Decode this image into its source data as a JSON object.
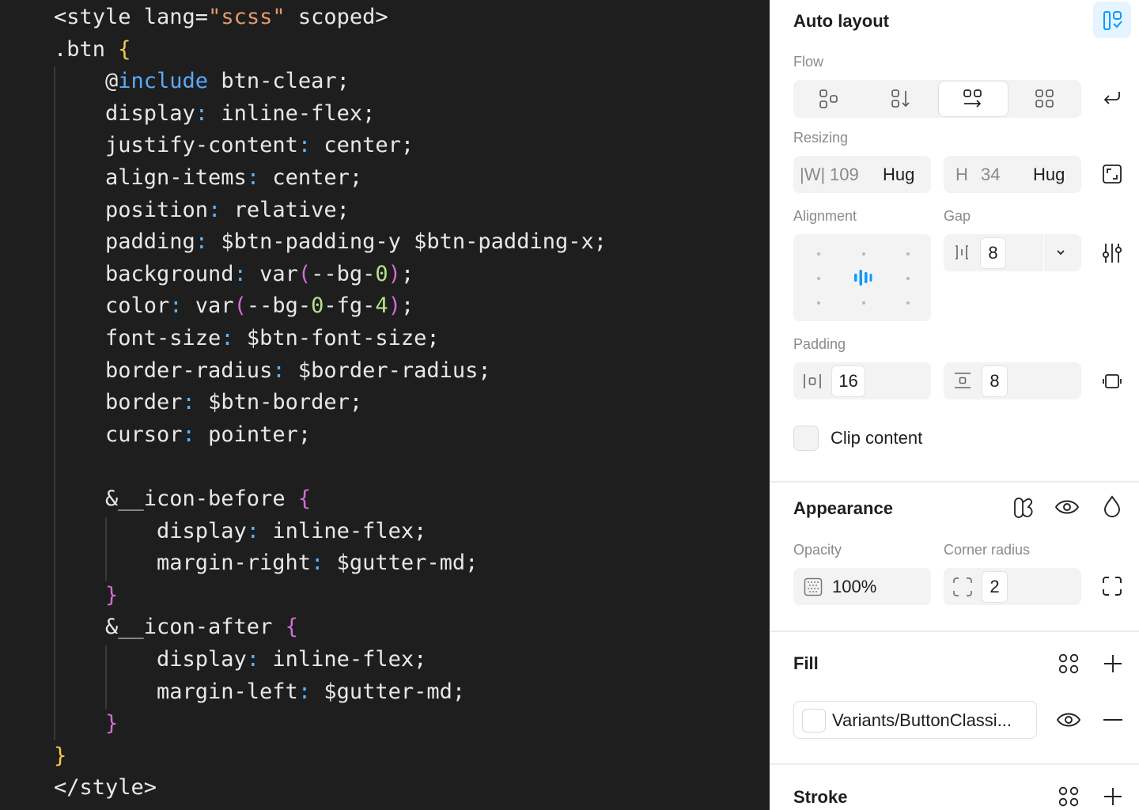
{
  "code": {
    "lines": [
      {
        "indent": 0,
        "tokens": [
          {
            "t": "<style lang=",
            "c": "t-tag"
          },
          {
            "t": "\"scss\"",
            "c": "t-str"
          },
          {
            "t": " scoped>",
            "c": "t-tag"
          }
        ]
      },
      {
        "indent": 0,
        "tokens": [
          {
            "t": ".btn ",
            "c": "t-tag"
          },
          {
            "t": "{",
            "c": "t-brace"
          }
        ]
      },
      {
        "indent": 1,
        "tokens": [
          {
            "t": "@",
            "c": "t-val"
          },
          {
            "t": "include",
            "c": "t-kw"
          },
          {
            "t": " btn-clear;",
            "c": "t-val"
          }
        ]
      },
      {
        "indent": 1,
        "tokens": [
          {
            "t": "display",
            "c": "t-prop"
          },
          {
            "t": ":",
            "c": "t-colon"
          },
          {
            "t": " inline-flex;",
            "c": "t-val"
          }
        ]
      },
      {
        "indent": 1,
        "tokens": [
          {
            "t": "justify-content",
            "c": "t-prop"
          },
          {
            "t": ":",
            "c": "t-colon"
          },
          {
            "t": " center;",
            "c": "t-val"
          }
        ]
      },
      {
        "indent": 1,
        "tokens": [
          {
            "t": "align-items",
            "c": "t-prop"
          },
          {
            "t": ":",
            "c": "t-colon"
          },
          {
            "t": " center;",
            "c": "t-val"
          }
        ]
      },
      {
        "indent": 1,
        "tokens": [
          {
            "t": "position",
            "c": "t-prop"
          },
          {
            "t": ":",
            "c": "t-colon"
          },
          {
            "t": " relative;",
            "c": "t-val"
          }
        ]
      },
      {
        "indent": 1,
        "tokens": [
          {
            "t": "padding",
            "c": "t-prop"
          },
          {
            "t": ":",
            "c": "t-colon"
          },
          {
            "t": " $btn-padding-y $btn-padding-x;",
            "c": "t-val"
          }
        ]
      },
      {
        "indent": 1,
        "tokens": [
          {
            "t": "background",
            "c": "t-prop"
          },
          {
            "t": ":",
            "c": "t-colon"
          },
          {
            "t": " var",
            "c": "t-val"
          },
          {
            "t": "(",
            "c": "t-paren"
          },
          {
            "t": "--bg-",
            "c": "t-val"
          },
          {
            "t": "0",
            "c": "t-num"
          },
          {
            "t": ")",
            "c": "t-paren"
          },
          {
            "t": ";",
            "c": "t-val"
          }
        ]
      },
      {
        "indent": 1,
        "tokens": [
          {
            "t": "color",
            "c": "t-prop"
          },
          {
            "t": ":",
            "c": "t-colon"
          },
          {
            "t": " var",
            "c": "t-val"
          },
          {
            "t": "(",
            "c": "t-paren"
          },
          {
            "t": "--bg-",
            "c": "t-val"
          },
          {
            "t": "0",
            "c": "t-num"
          },
          {
            "t": "-fg-",
            "c": "t-val"
          },
          {
            "t": "4",
            "c": "t-num"
          },
          {
            "t": ")",
            "c": "t-paren"
          },
          {
            "t": ";",
            "c": "t-val"
          }
        ]
      },
      {
        "indent": 1,
        "tokens": [
          {
            "t": "font-size",
            "c": "t-prop"
          },
          {
            "t": ":",
            "c": "t-colon"
          },
          {
            "t": " $btn-font-size;",
            "c": "t-val"
          }
        ]
      },
      {
        "indent": 1,
        "tokens": [
          {
            "t": "border-radius",
            "c": "t-prop"
          },
          {
            "t": ":",
            "c": "t-colon"
          },
          {
            "t": " $border-radius;",
            "c": "t-val"
          }
        ]
      },
      {
        "indent": 1,
        "tokens": [
          {
            "t": "border",
            "c": "t-prop"
          },
          {
            "t": ":",
            "c": "t-colon"
          },
          {
            "t": " $btn-border;",
            "c": "t-val"
          }
        ]
      },
      {
        "indent": 1,
        "tokens": [
          {
            "t": "cursor",
            "c": "t-prop"
          },
          {
            "t": ":",
            "c": "t-colon"
          },
          {
            "t": " pointer;",
            "c": "t-val"
          }
        ]
      },
      {
        "indent": 0,
        "tokens": []
      },
      {
        "indent": 1,
        "tokens": [
          {
            "t": "&__icon-before ",
            "c": "t-val"
          },
          {
            "t": "{",
            "c": "t-brace2"
          }
        ]
      },
      {
        "indent": 2,
        "tokens": [
          {
            "t": "display",
            "c": "t-prop"
          },
          {
            "t": ":",
            "c": "t-colon"
          },
          {
            "t": " inline-flex;",
            "c": "t-val"
          }
        ]
      },
      {
        "indent": 2,
        "tokens": [
          {
            "t": "margin-right",
            "c": "t-prop"
          },
          {
            "t": ":",
            "c": "t-colon"
          },
          {
            "t": " $gutter-md;",
            "c": "t-val"
          }
        ]
      },
      {
        "indent": 1,
        "tokens": [
          {
            "t": "}",
            "c": "t-brace2"
          }
        ]
      },
      {
        "indent": 1,
        "tokens": [
          {
            "t": "&__icon-after ",
            "c": "t-val"
          },
          {
            "t": "{",
            "c": "t-brace2"
          }
        ]
      },
      {
        "indent": 2,
        "tokens": [
          {
            "t": "display",
            "c": "t-prop"
          },
          {
            "t": ":",
            "c": "t-colon"
          },
          {
            "t": " inline-flex;",
            "c": "t-val"
          }
        ]
      },
      {
        "indent": 2,
        "tokens": [
          {
            "t": "margin-left",
            "c": "t-prop"
          },
          {
            "t": ":",
            "c": "t-colon"
          },
          {
            "t": " $gutter-md;",
            "c": "t-val"
          }
        ]
      },
      {
        "indent": 1,
        "tokens": [
          {
            "t": "}",
            "c": "t-brace2"
          }
        ]
      },
      {
        "indent": 0,
        "tokens": [
          {
            "t": "}",
            "c": "t-brace"
          }
        ]
      },
      {
        "indent": 0,
        "tokens": [
          {
            "t": "</style>",
            "c": "t-tag"
          }
        ]
      }
    ]
  },
  "panel": {
    "auto_layout": {
      "title": "Auto layout"
    },
    "flow": {
      "label": "Flow",
      "selected": "wrap"
    },
    "resizing": {
      "label": "Resizing",
      "w_label": "|W|",
      "w_value": "109",
      "w_mode": "Hug",
      "h_label": "H",
      "h_value": "34",
      "h_mode": "Hug"
    },
    "alignment": {
      "label": "Alignment"
    },
    "gap": {
      "label": "Gap",
      "value": "8"
    },
    "padding": {
      "label": "Padding",
      "horizontal": "16",
      "vertical": "8"
    },
    "clip": {
      "label": "Clip content"
    },
    "appearance": {
      "title": "Appearance",
      "opacity_label": "Opacity",
      "opacity_value": "100%",
      "radius_label": "Corner radius",
      "radius_value": "2"
    },
    "fill": {
      "title": "Fill",
      "style_name": "Variants/ButtonClassi..."
    },
    "stroke": {
      "title": "Stroke"
    },
    "colors": {
      "accent": "#0d99ff"
    }
  }
}
